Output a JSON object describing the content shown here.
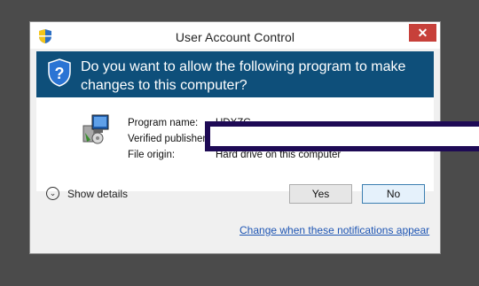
{
  "window": {
    "title": "User Account Control",
    "close_glyph": "✕"
  },
  "header": {
    "question": "Do you want to allow the following program to make changes to this computer?",
    "icon": "shield-icon"
  },
  "program": {
    "name_label": "Program name:",
    "name_value": "UDXZG",
    "publisher_label": "Verified publisher:",
    "publisher_value": "",
    "origin_label": "File origin:",
    "origin_value": "Hard drive on this computer"
  },
  "details": {
    "label": "Show details",
    "icon": "chevron-down-icon"
  },
  "buttons": {
    "yes": "Yes",
    "no": "No"
  },
  "link": "Change when these notifications appear",
  "colors": {
    "header": "#0e4f7a",
    "close": "#c7403a",
    "link": "#1e55b3",
    "redaction": "#1e0a55"
  }
}
